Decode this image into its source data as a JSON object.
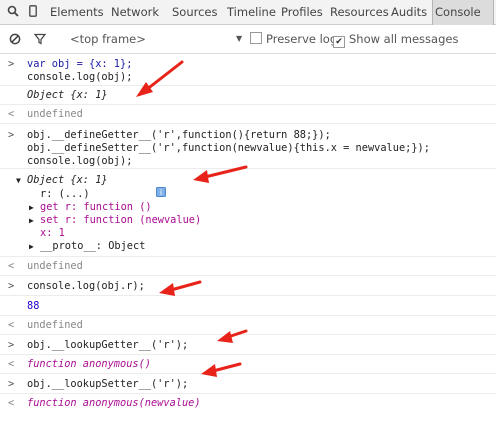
{
  "tabbar": {
    "tabs": [
      "Elements",
      "Network",
      "Sources",
      "Timeline",
      "Profiles",
      "Resources",
      "Audits",
      "Console"
    ],
    "active_tab": "Console"
  },
  "toolbar": {
    "frame_label": "<top frame>",
    "preserve_log_label": "Preserve log",
    "show_all_label": "Show all messages",
    "preserve_log_checked": false,
    "show_all_checked": true
  },
  "console": {
    "in1": [
      "var obj = {x: 1};",
      "console.log(obj);"
    ],
    "out1": "Object {x: 1}",
    "ret1": "undefined",
    "in2": [
      "obj.__defineGetter__('r',function(){return 88;});",
      "obj.__defineSetter__('r',function(newvalue){this.x = newvalue;});",
      "console.log(obj);"
    ],
    "obj2": {
      "head": "Object {x: 1}",
      "lines": [
        "r: (...)",
        "get r: function ()",
        "set r: function (newvalue)",
        "x: 1",
        "__proto__: Object"
      ]
    },
    "ret2": "undefined",
    "in3": "console.log(obj.r);",
    "out3": "88",
    "ret3": "undefined",
    "in4": "obj.__lookupGetter__('r');",
    "out4": "function anonymous()",
    "in5": "obj.__lookupSetter__('r');",
    "out5": "function anonymous(newvalue)",
    "prompt_in": ">",
    "prompt_out": "<"
  },
  "colors": {
    "arrow": "#e8231a",
    "accent": "#1a1aa6"
  }
}
